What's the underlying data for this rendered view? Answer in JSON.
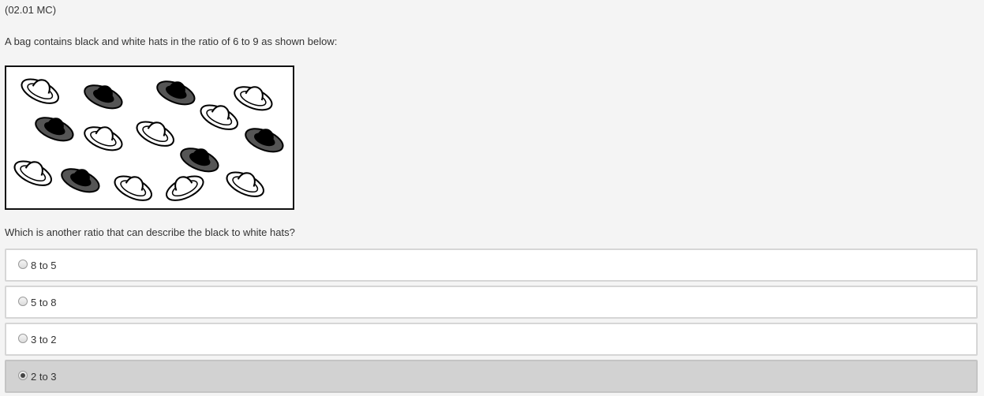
{
  "question_code": "(02.01 MC)",
  "stem": "A bag contains black and white hats in the ratio of 6 to 9 as shown below:",
  "figure": {
    "black_hats": 6,
    "white_hats": 9,
    "colors": {
      "black_crown": "#000000",
      "black_brim": "#555555",
      "white_fill": "#ffffff",
      "outline": "#000000"
    }
  },
  "question": "Which is another ratio that can describe the black to white hats?",
  "choices": [
    {
      "label": "8 to 5",
      "selected": false
    },
    {
      "label": "5 to 8",
      "selected": false
    },
    {
      "label": "3 to 2",
      "selected": false
    },
    {
      "label": "2 to 3",
      "selected": true
    }
  ]
}
